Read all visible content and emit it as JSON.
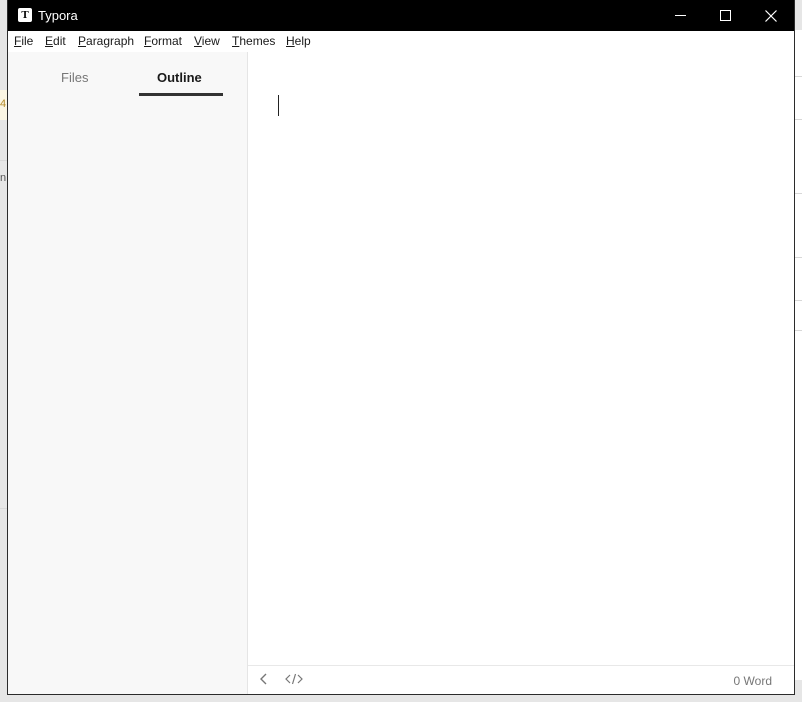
{
  "window": {
    "title": "Typora",
    "app_icon_glyph": "T"
  },
  "menu": {
    "items": [
      {
        "label": "File",
        "mnemonic": "F",
        "rest": "ile"
      },
      {
        "label": "Edit",
        "mnemonic": "E",
        "rest": "dit"
      },
      {
        "label": "Paragraph",
        "mnemonic": "P",
        "rest": "aragraph"
      },
      {
        "label": "Format",
        "mnemonic": "F",
        "rest": "ormat"
      },
      {
        "label": "View",
        "mnemonic": "V",
        "rest": "iew"
      },
      {
        "label": "Themes",
        "mnemonic": "T",
        "rest": "hemes"
      },
      {
        "label": "Help",
        "mnemonic": "H",
        "rest": "elp"
      }
    ]
  },
  "sidebar": {
    "tabs": [
      {
        "label": "Files",
        "active": false
      },
      {
        "label": "Outline",
        "active": true
      }
    ]
  },
  "footer": {
    "word_count": "0 Word"
  },
  "background": {
    "edge_text_1": "4",
    "edge_text_2": "n"
  },
  "colors": {
    "titlebar": "#000000",
    "sidebar": "#f8f8f8",
    "active_tab_underline": "#333333"
  }
}
